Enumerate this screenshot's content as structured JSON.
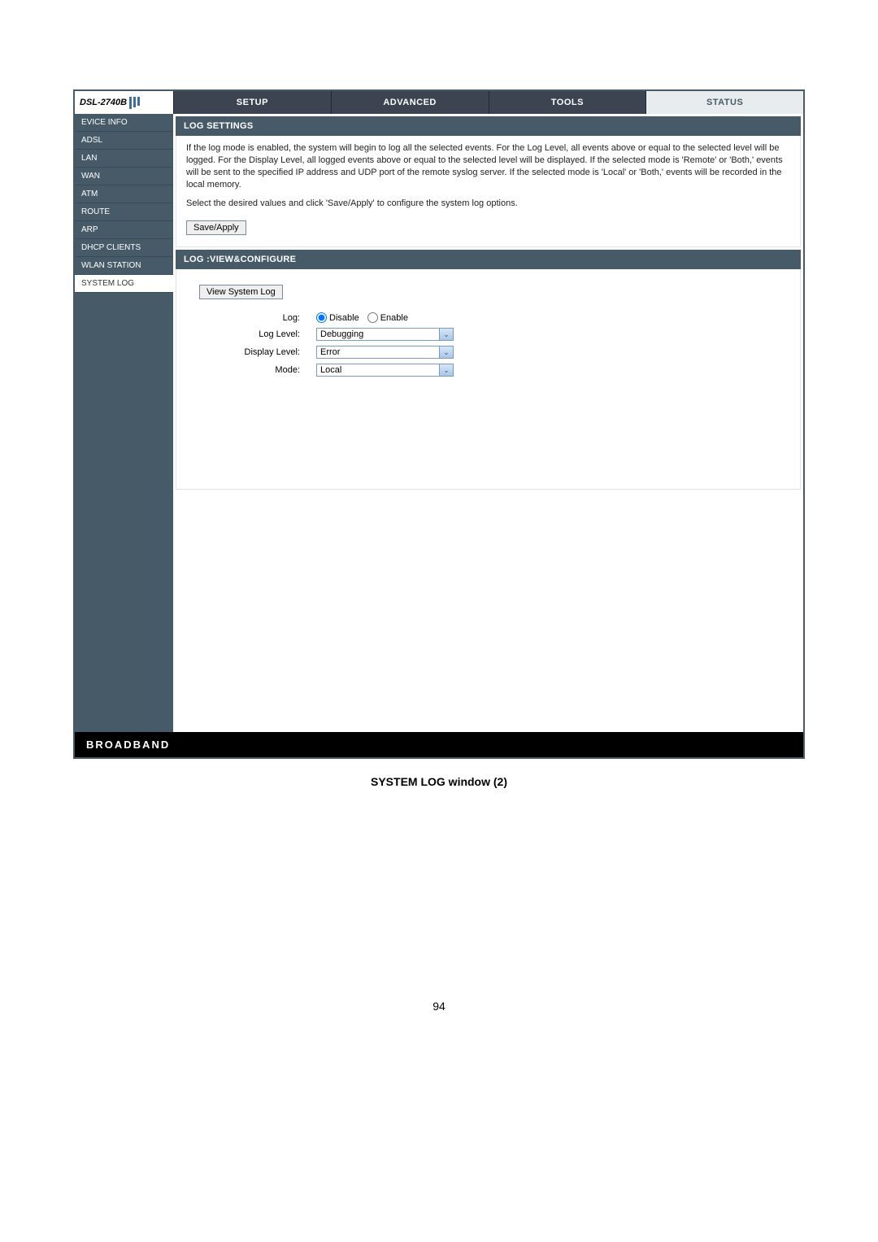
{
  "model": "DSL-2740B",
  "tabs": {
    "setup": "SETUP",
    "advanced": "ADVANCED",
    "tools": "TOOLS",
    "status": "STATUS"
  },
  "sidebar": {
    "items": [
      {
        "label": "EVICE INFO"
      },
      {
        "label": "ADSL"
      },
      {
        "label": "LAN"
      },
      {
        "label": "WAN"
      },
      {
        "label": "ATM"
      },
      {
        "label": "ROUTE"
      },
      {
        "label": "ARP"
      },
      {
        "label": "DHCP CLIENTS"
      },
      {
        "label": "WLAN STATION"
      },
      {
        "label": "SYSTEM LOG"
      }
    ]
  },
  "panels": {
    "settings": {
      "title": "LOG SETTINGS",
      "desc": "If the log mode is enabled, the system will begin to log all the selected events. For the Log Level, all events above or equal to the selected level will be logged. For the Display Level, all logged events above or equal to the selected level will be displayed. If the selected mode is 'Remote' or 'Both,' events will be sent to the specified IP address and UDP port of the remote syslog server. If the selected mode is 'Local' or 'Both,' events will be recorded in the local memory.",
      "instr": "Select the desired values and click 'Save/Apply' to configure the system log options.",
      "save_label": "Save/Apply"
    },
    "configure": {
      "title": "LOG :VIEW&CONFIGURE",
      "view_btn": "View System Log",
      "labels": {
        "log": "Log:",
        "log_level": "Log Level:",
        "display_level": "Display Level:",
        "mode": "Mode:"
      },
      "radio": {
        "disable": "Disable",
        "enable": "Enable",
        "selected": "disable"
      },
      "selects": {
        "log_level": "Debugging",
        "display_level": "Error",
        "mode": "Local"
      }
    }
  },
  "footer": "BROADBAND",
  "caption": "SYSTEM LOG window (2)",
  "page_number": "94"
}
